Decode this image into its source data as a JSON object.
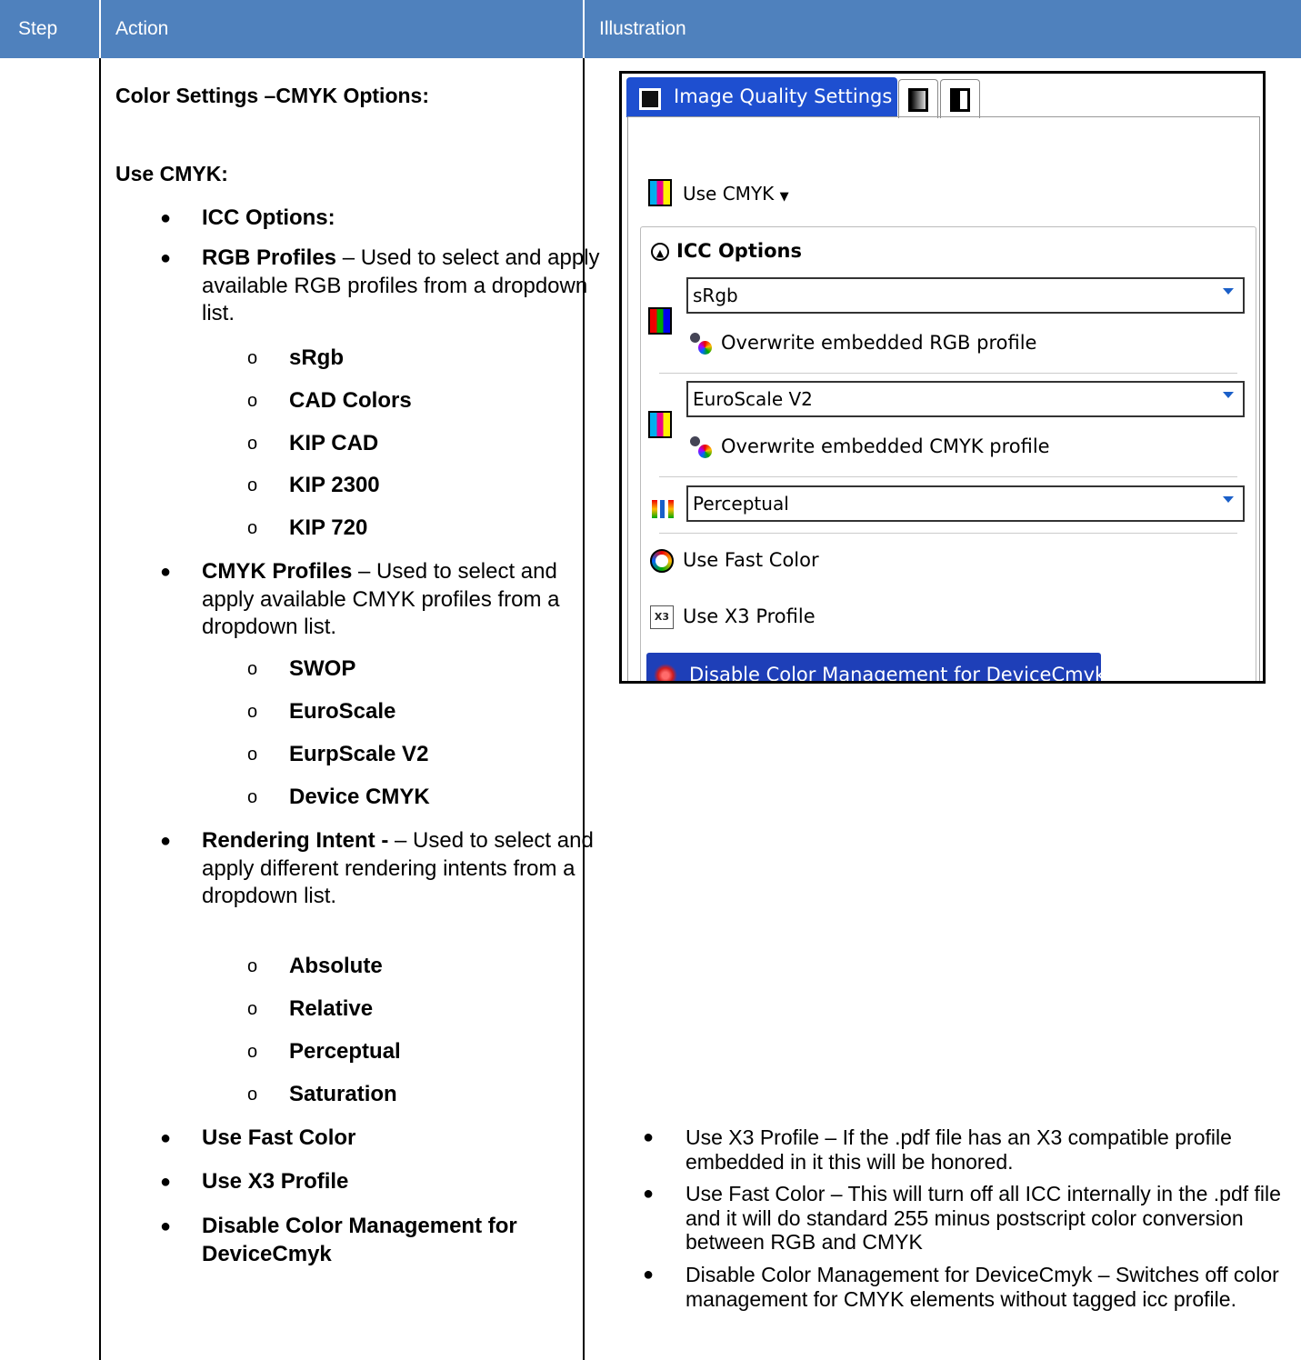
{
  "table": {
    "headers": [
      "Step",
      "Action",
      "Illustration"
    ]
  },
  "action": {
    "title": "Color Settings –CMYK Options:",
    "use_cmyk": "Use CMYK:",
    "icc_options": "ICC Options:",
    "rgb_profiles": {
      "bold": "RGB Profiles",
      "rest": " – Used to select and apply available RGB profiles from a dropdown list."
    },
    "rgb_items": [
      "sRgb",
      "CAD Colors",
      "KIP CAD",
      "KIP 2300",
      "KIP 720"
    ],
    "cmyk_profiles": {
      "bold": "CMYK Profiles",
      "rest": " – Used to select and apply available CMYK profiles from a dropdown list."
    },
    "cmyk_items": [
      "SWOP",
      "EuroScale",
      "EurpScale V2",
      "Device CMYK"
    ],
    "rendering_intent": {
      "bold": "Rendering Intent - ",
      "rest": "– Used to select and apply different rendering intents from a dropdown list."
    },
    "intent_items": [
      "Absolute",
      "Relative",
      "Perceptual",
      "Saturation"
    ],
    "bottom_items": [
      "Use Fast Color",
      "Use X3 Profile",
      "Disable Color Management for DeviceCmyk"
    ]
  },
  "screenshot": {
    "tab_active": "Image Quality Settings",
    "use_cmyk": "Use CMYK",
    "icc_title": "ICC Options",
    "rgb_value": "sRgb",
    "rgb_overwrite": "Overwrite embedded RGB profile",
    "cmyk_value": "EuroScale V2",
    "cmyk_overwrite": "Overwrite embedded CMYK profile",
    "intent_value": "Perceptual",
    "fast_color": "Use Fast Color",
    "x3_profile": "Use X3 Profile",
    "x3_icon_text": "X3",
    "disable_cm": "Disable Color Management for DeviceCmyk"
  },
  "illustration_notes": [
    "Use X3 Profile – If the .pdf file has an X3 compatible profile embedded in it this will be honored.",
    "Use Fast Color – This will turn off all ICC internally in the .pdf file and it will do standard 255 minus postscript color conversion between RGB and CMYK",
    "Disable Color Management for DeviceCmyk – Switches off color management for CMYK elements without tagged icc profile."
  ]
}
